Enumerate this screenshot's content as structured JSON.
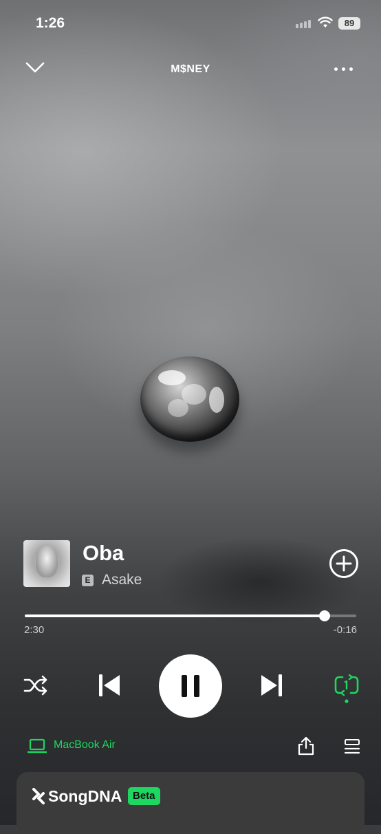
{
  "status_bar": {
    "time": "1:26",
    "battery": "89"
  },
  "header": {
    "album_title": "M$NEY"
  },
  "track": {
    "title": "Oba",
    "explicit_badge": "E",
    "artist": "Asake"
  },
  "progress": {
    "elapsed": "2:30",
    "remaining": "-0:16",
    "fraction": 0.9036
  },
  "device": {
    "label": "MacBook Air"
  },
  "songdna": {
    "title": "SongDNA",
    "badge": "Beta"
  },
  "icons": {
    "collapse": "chevron-down-icon",
    "menu": "more-icon",
    "add": "add-circle-icon",
    "shuffle": "shuffle-icon",
    "previous": "skip-previous-icon",
    "play_pause": "pause-icon",
    "next": "skip-next-icon",
    "repeat": "repeat-one-icon",
    "device": "laptop-icon",
    "share": "share-icon",
    "queue": "queue-icon"
  },
  "colors": {
    "accent": "#1ed760",
    "text": "#ffffff",
    "card": "#3b3b3b"
  }
}
